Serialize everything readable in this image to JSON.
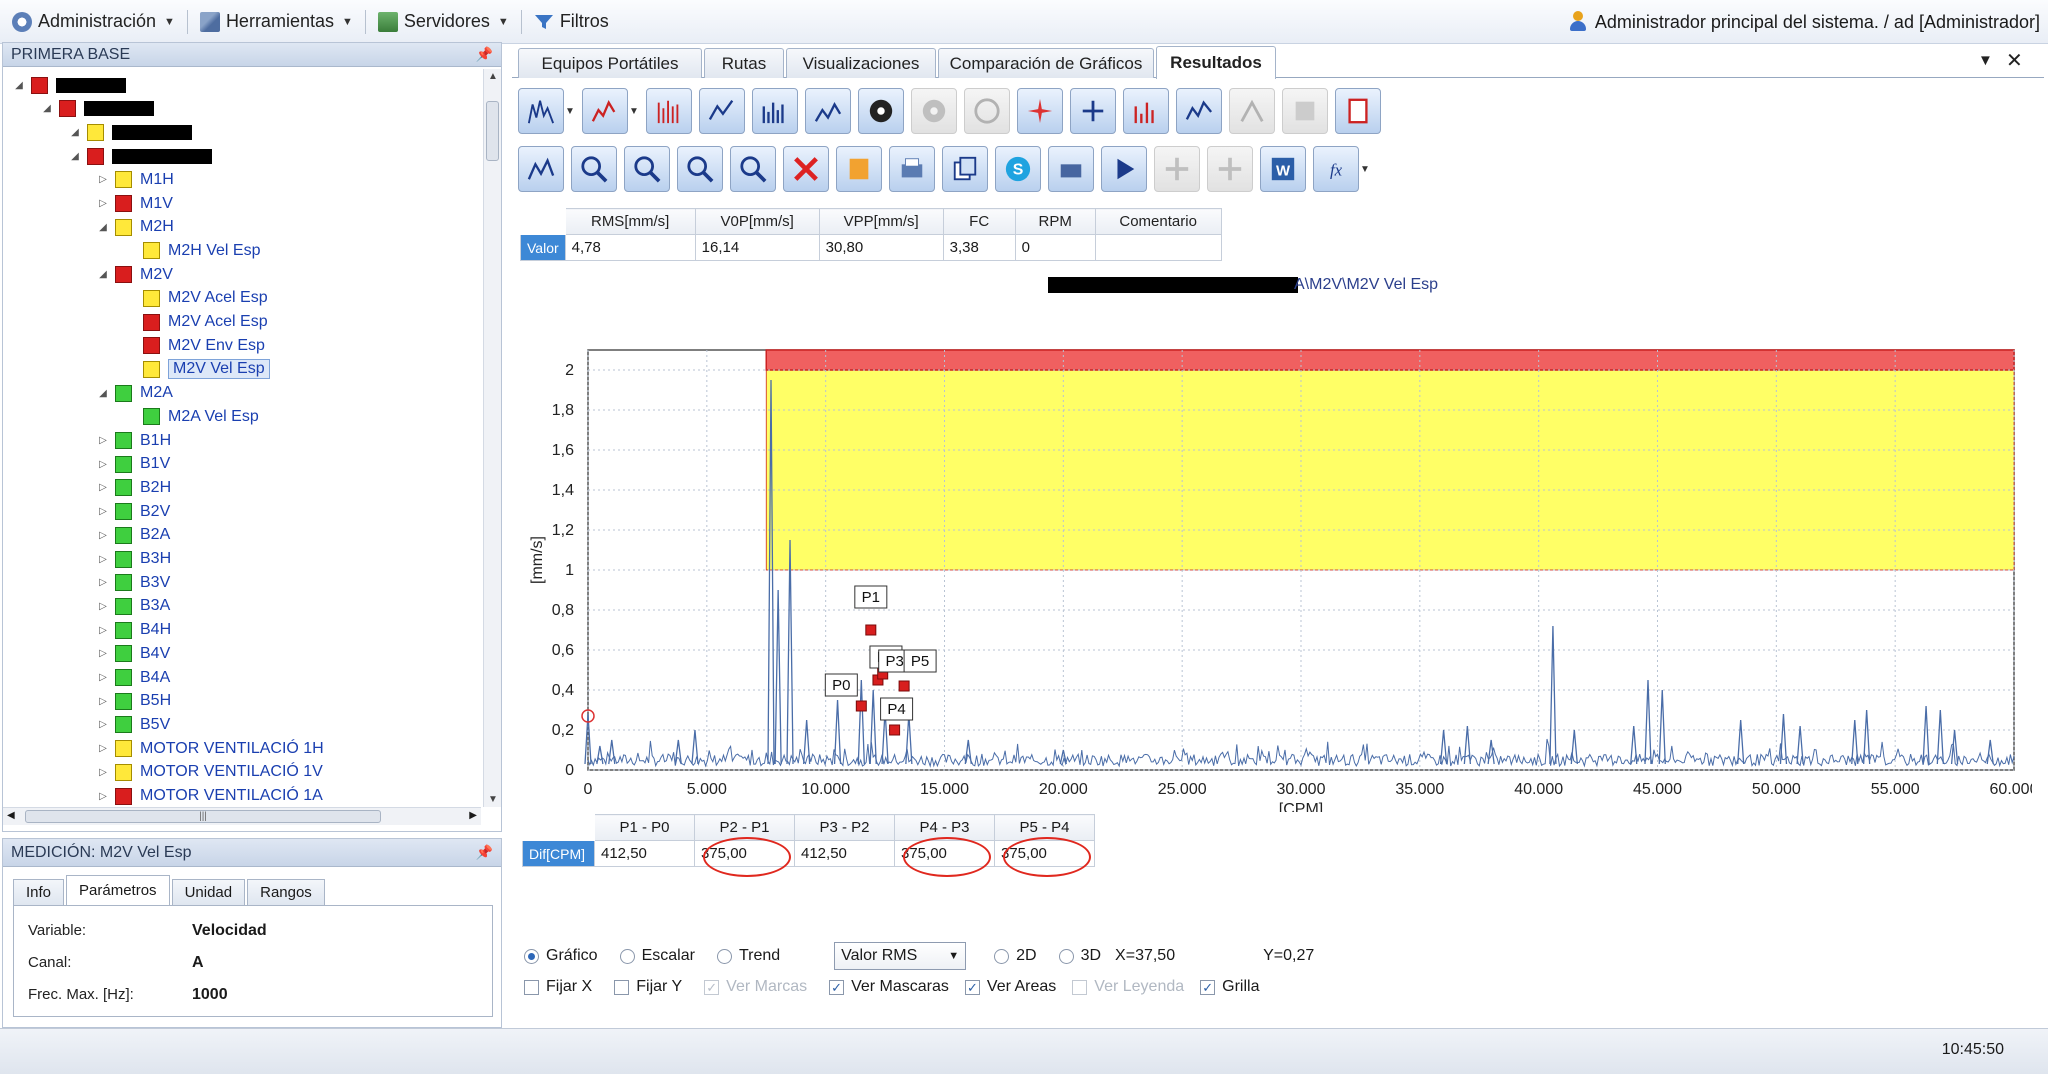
{
  "menubar": {
    "items": [
      {
        "label": "Administración",
        "icon": "gear-icon"
      },
      {
        "label": "Herramientas",
        "icon": "wrench-icon"
      },
      {
        "label": "Servidores",
        "icon": "server-icon"
      },
      {
        "label": "Filtros",
        "icon": "filter-icon"
      }
    ],
    "user": "Administrador principal del sistema. / ad [Administrador]"
  },
  "tree_panel": {
    "title": "PRIMERA BASE",
    "items": [
      {
        "label": "",
        "color": "red",
        "level": 0,
        "redact": 70
      },
      {
        "label": "",
        "color": "red",
        "level": 1,
        "redact": 70
      },
      {
        "label": "",
        "color": "yellow",
        "level": 2,
        "redact": 80
      },
      {
        "label": "",
        "color": "red",
        "level": 2,
        "redact": 100
      },
      {
        "label": "M1H",
        "color": "yellow",
        "level": 3
      },
      {
        "label": "M1V",
        "color": "red",
        "level": 3
      },
      {
        "label": "M2H",
        "color": "yellow",
        "level": 3
      },
      {
        "label": "M2H Vel Esp",
        "color": "yellow",
        "level": 4
      },
      {
        "label": "M2V",
        "color": "red",
        "level": 3
      },
      {
        "label": "M2V Acel Esp",
        "color": "yellow",
        "level": 4
      },
      {
        "label": "M2V Acel Esp",
        "color": "red",
        "level": 4
      },
      {
        "label": "M2V Env Esp",
        "color": "red",
        "level": 4
      },
      {
        "label": "M2V Vel Esp",
        "color": "yellow",
        "level": 4,
        "selected": true
      },
      {
        "label": "M2A",
        "color": "green",
        "level": 3
      },
      {
        "label": "M2A Vel Esp",
        "color": "green",
        "level": 4
      },
      {
        "label": "B1H",
        "color": "green",
        "level": 3
      },
      {
        "label": "B1V",
        "color": "green",
        "level": 3
      },
      {
        "label": "B2H",
        "color": "green",
        "level": 3
      },
      {
        "label": "B2V",
        "color": "green",
        "level": 3
      },
      {
        "label": "B2A",
        "color": "green",
        "level": 3
      },
      {
        "label": "B3H",
        "color": "green",
        "level": 3
      },
      {
        "label": "B3V",
        "color": "green",
        "level": 3
      },
      {
        "label": "B3A",
        "color": "green",
        "level": 3
      },
      {
        "label": "B4H",
        "color": "green",
        "level": 3
      },
      {
        "label": "B4V",
        "color": "green",
        "level": 3
      },
      {
        "label": "B4A",
        "color": "green",
        "level": 3
      },
      {
        "label": "B5H",
        "color": "green",
        "level": 3
      },
      {
        "label": "B5V",
        "color": "green",
        "level": 3
      },
      {
        "label": "MOTOR VENTILACIÓ 1H",
        "color": "yellow",
        "level": 3
      },
      {
        "label": "MOTOR VENTILACIÓ 1V",
        "color": "yellow",
        "level": 3
      },
      {
        "label": "MOTOR VENTILACIÓ 1A",
        "color": "red",
        "level": 3
      }
    ]
  },
  "medicion_panel": {
    "title": "MEDICIÓN: M2V Vel Esp",
    "tabs": [
      "Info",
      "Parámetros",
      "Unidad",
      "Rangos"
    ],
    "active_tab": "Parámetros",
    "params": [
      {
        "key": "Variable:",
        "value": "Velocidad"
      },
      {
        "key": "Canal:",
        "value": "A"
      },
      {
        "key": "Frec. Max. [Hz]:",
        "value": "1000"
      }
    ]
  },
  "tabs": [
    "Equipos Portátiles",
    "Rutas",
    "Visualizaciones",
    "Comparación de Gráficos",
    "Resultados"
  ],
  "active_tab": "Resultados",
  "measurements": {
    "headers": [
      "RMS[mm/s]",
      "V0P[mm/s]",
      "VPP[mm/s]",
      "FC",
      "RPM",
      "Comentario"
    ],
    "row_label": "Valor",
    "values": [
      "4,78",
      "16,14",
      "30,80",
      "3,38",
      "0",
      ""
    ]
  },
  "chart_title_suffix": "A\\M2V\\M2V Vel Esp",
  "chart_data": {
    "type": "line",
    "xlabel": "[CPM]",
    "ylabel": "[mm/s]",
    "xlim": [
      0,
      60000
    ],
    "ylim": [
      0,
      2.1
    ],
    "x_ticks": [
      "0",
      "5.000",
      "10.000",
      "15.000",
      "20.000",
      "25.000",
      "30.000",
      "35.000",
      "40.000",
      "45.000",
      "50.000",
      "55.000",
      "60.000"
    ],
    "y_ticks": [
      "0",
      "0,2",
      "0,4",
      "0,6",
      "0,8",
      "1",
      "1,2",
      "1,4",
      "1,6",
      "1,8",
      "2"
    ],
    "alarm_zones": [
      {
        "level": "warning",
        "color": "#ffff66",
        "x_from": 7500,
        "y_from": 1.0,
        "y_to": 2.0
      },
      {
        "level": "danger",
        "color": "#f06060",
        "x_from": 7500,
        "y_from": 2.0,
        "y_to": 2.1
      }
    ],
    "peaks": [
      {
        "x": 0,
        "y": 0.28
      },
      {
        "x": 500,
        "y": 0.12
      },
      {
        "x": 1000,
        "y": 0.15
      },
      {
        "x": 3800,
        "y": 0.15
      },
      {
        "x": 4500,
        "y": 0.2
      },
      {
        "x": 7700,
        "y": 1.95
      },
      {
        "x": 8000,
        "y": 0.9
      },
      {
        "x": 8500,
        "y": 1.15
      },
      {
        "x": 9200,
        "y": 0.25
      },
      {
        "x": 10500,
        "y": 0.35
      },
      {
        "x": 11500,
        "y": 0.45
      },
      {
        "x": 12000,
        "y": 0.4
      },
      {
        "x": 12500,
        "y": 0.3
      },
      {
        "x": 13500,
        "y": 0.28
      },
      {
        "x": 16000,
        "y": 0.15
      },
      {
        "x": 20000,
        "y": 0.1
      },
      {
        "x": 36000,
        "y": 0.2
      },
      {
        "x": 37000,
        "y": 0.22
      },
      {
        "x": 38000,
        "y": 0.15
      },
      {
        "x": 40600,
        "y": 0.72
      },
      {
        "x": 41500,
        "y": 0.2
      },
      {
        "x": 44000,
        "y": 0.22
      },
      {
        "x": 44600,
        "y": 0.45
      },
      {
        "x": 45200,
        "y": 0.4
      },
      {
        "x": 48500,
        "y": 0.25
      },
      {
        "x": 50300,
        "y": 0.28
      },
      {
        "x": 51000,
        "y": 0.22
      },
      {
        "x": 53300,
        "y": 0.25
      },
      {
        "x": 53800,
        "y": 0.3
      },
      {
        "x": 56300,
        "y": 0.32
      },
      {
        "x": 56900,
        "y": 0.3
      },
      {
        "x": 57500,
        "y": 0.2
      },
      {
        "x": 59000,
        "y": 0.15
      }
    ],
    "markers": [
      {
        "label": "P0",
        "x": 11500,
        "y": 0.32
      },
      {
        "label": "P1",
        "x": 11900,
        "y": 0.7
      },
      {
        "label": "P2",
        "x": 12200,
        "y": 0.45
      },
      {
        "label": "P3",
        "x": 12400,
        "y": 0.48
      },
      {
        "label": "P4",
        "x": 12900,
        "y": 0.2
      },
      {
        "label": "P5",
        "x": 13300,
        "y": 0.42
      }
    ],
    "cursor": {
      "x": 37.5,
      "y": 0.27
    }
  },
  "differences": {
    "headers": [
      "P1 - P0",
      "P2 - P1",
      "P3 - P2",
      "P4 - P3",
      "P5 - P4"
    ],
    "row_label": "Dif[CPM]",
    "values": [
      "412,50",
      "375,00",
      "412,50",
      "375,00",
      "375,00"
    ],
    "circled": [
      false,
      true,
      false,
      true,
      true
    ]
  },
  "options": {
    "view_modes": [
      "Gráfico",
      "Escalar",
      "Trend"
    ],
    "selected_view": "Gráfico",
    "value_select": "Valor RMS",
    "dims": [
      "2D",
      "3D"
    ],
    "cursor_x": "X=37,50",
    "cursor_y": "Y=0,27",
    "checkboxes": [
      {
        "label": "Fijar X",
        "checked": false,
        "enabled": true
      },
      {
        "label": "Fijar Y",
        "checked": false,
        "enabled": true
      },
      {
        "label": "Ver Marcas",
        "checked": true,
        "enabled": false
      },
      {
        "label": "Ver Mascaras",
        "checked": true,
        "enabled": true
      },
      {
        "label": "Ver Areas",
        "checked": true,
        "enabled": true
      },
      {
        "label": "Ver Leyenda",
        "checked": false,
        "enabled": false
      },
      {
        "label": "Grilla",
        "checked": true,
        "enabled": true
      }
    ]
  },
  "status": {
    "time": "10:45:50"
  },
  "colors": {
    "accent": "#3d88d6",
    "link": "#1a3fb0",
    "warning": "#ffff66",
    "danger": "#f06060",
    "spectrum": "#4a6da8"
  }
}
